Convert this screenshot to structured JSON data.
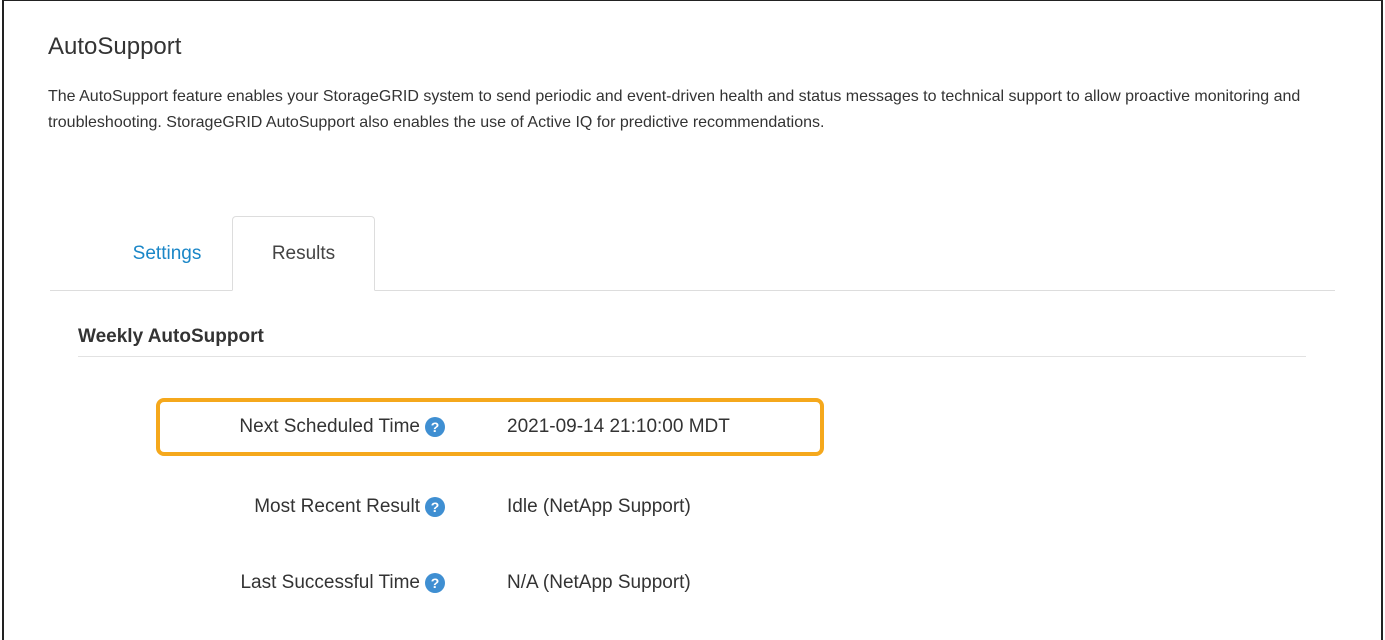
{
  "page": {
    "title": "AutoSupport",
    "description": "The AutoSupport feature enables your StorageGRID system to send periodic and event-driven health and status messages to technical support to allow proactive monitoring and troubleshooting. StorageGRID AutoSupport also enables the use of Active IQ for predictive recommendations."
  },
  "tabs": [
    {
      "label": "Settings",
      "active": false
    },
    {
      "label": "Results",
      "active": true
    }
  ],
  "section": {
    "heading": "Weekly AutoSupport"
  },
  "rows": [
    {
      "label": "Next Scheduled Time",
      "help_icon": "question-circle-icon",
      "value": "2021-09-14 21:10:00 MDT",
      "highlighted": true
    },
    {
      "label": "Most Recent Result",
      "help_icon": "question-circle-icon",
      "value": "Idle (NetApp Support)",
      "highlighted": false
    },
    {
      "label": "Last Successful Time",
      "help_icon": "question-circle-icon",
      "value": "N/A (NetApp Support)",
      "highlighted": false
    }
  ],
  "colors": {
    "link": "#1a86c7",
    "help_icon": "#3f8fd2",
    "highlight": "#f5a81c"
  }
}
